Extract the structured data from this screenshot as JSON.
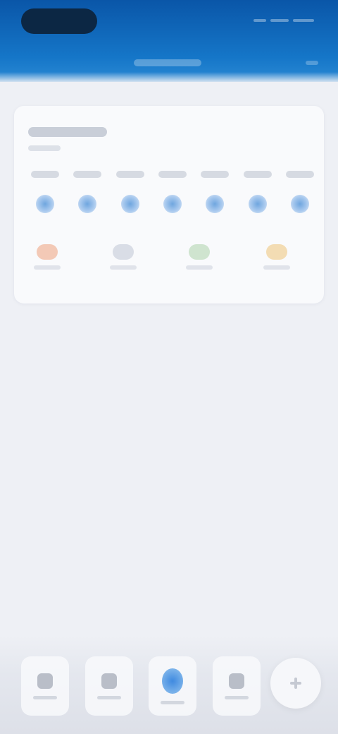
{
  "header": {
    "brand_color": "#0a56a8",
    "logo_color": "#0c2744"
  },
  "card": {
    "title": "",
    "subtitle": "",
    "days": [
      "",
      "",
      "",
      "",
      "",
      "",
      ""
    ],
    "summary": [
      {
        "icon": "activity-icon",
        "color": "#f3c9b6"
      },
      {
        "icon": "chart-icon",
        "color": "#d9dde6"
      },
      {
        "icon": "leaf-icon",
        "color": "#cfe4cf"
      },
      {
        "icon": "sun-icon",
        "color": "#f3dcb3"
      }
    ]
  },
  "nav": {
    "items": [
      {
        "icon": "person-icon",
        "label": ""
      },
      {
        "icon": "grid-icon",
        "label": ""
      },
      {
        "icon": "location-icon",
        "label": "",
        "active": true
      },
      {
        "icon": "list-icon",
        "label": ""
      }
    ],
    "accent_color": "#3f8ae0"
  }
}
